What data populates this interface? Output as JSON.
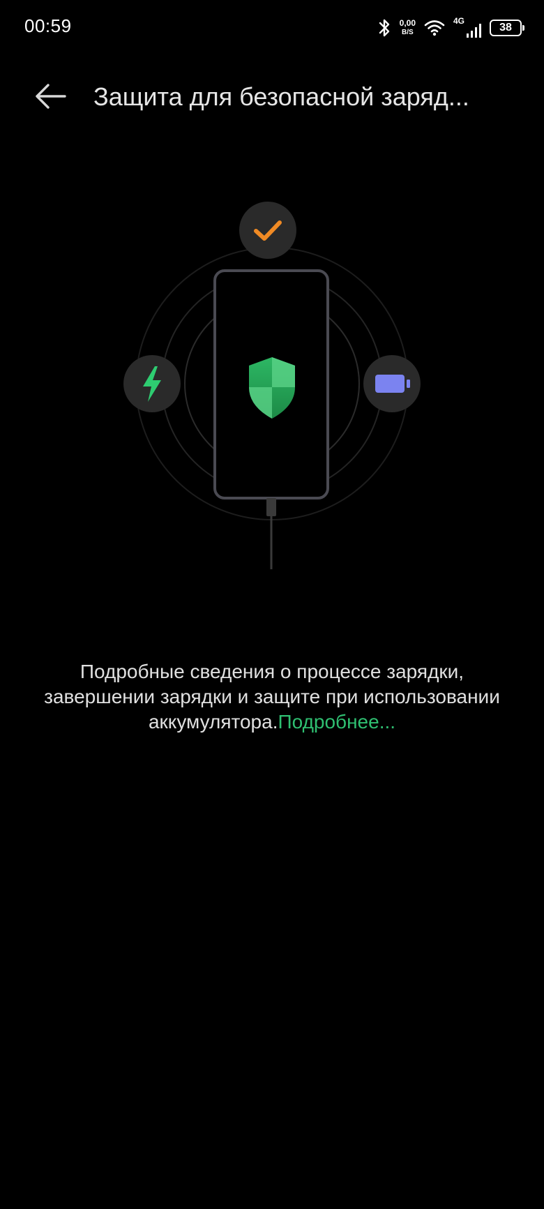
{
  "status_bar": {
    "time": "00:59",
    "net_speed_value": "0,00",
    "net_speed_unit": "B/S",
    "network_type": "4G",
    "battery_level": "38",
    "icons": [
      "bluetooth-icon",
      "wifi-icon",
      "signal-icon",
      "battery-icon"
    ]
  },
  "header": {
    "title": "Защита для безопасной заряд...",
    "back_icon": "arrow-left-icon"
  },
  "illustration": {
    "icons": [
      "checkmark-icon",
      "lightning-icon",
      "battery-icon",
      "shield-icon",
      "phone-icon",
      "cable-icon"
    ],
    "colors": {
      "check": "#f08a24",
      "lightning": "#2ecc71",
      "battery": "#7b83f0",
      "shield_dark": "#1f9e4f",
      "shield_light": "#5ed48a",
      "badge_bg": "#2a2a2a",
      "phone_outline": "#4a4a52"
    }
  },
  "description": {
    "text": "Подробные сведения о процессе зарядки, завершении зарядки и защите при использовании аккумулятора.",
    "link": "Подробнее..."
  },
  "accent_color": "#2fbf71"
}
